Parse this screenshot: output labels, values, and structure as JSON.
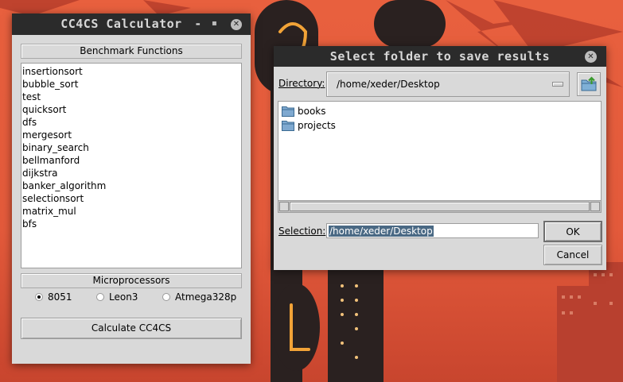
{
  "calculator_window": {
    "title": "CC4CS Calculator",
    "minimize_symbol": "-",
    "close_symbol": "✕",
    "benchmark_header": "Benchmark Functions",
    "functions": [
      "insertionsort",
      "bubble_sort",
      "test",
      "quicksort",
      "dfs",
      "mergesort",
      "binary_search",
      "bellmanford",
      "dijkstra",
      "banker_algorithm",
      "selectionsort",
      "matrix_mul",
      "bfs"
    ],
    "microprocessors_header": "Microprocessors",
    "microprocessors": [
      {
        "label": "8051",
        "selected": true
      },
      {
        "label": "Leon3",
        "selected": false
      },
      {
        "label": "Atmega328p",
        "selected": false
      }
    ],
    "calculate_button": "Calculate CC4CS"
  },
  "folder_dialog": {
    "title": "Select folder to save results",
    "close_symbol": "✕",
    "directory_label": "Directory:",
    "directory_value": "/home/xeder/Desktop",
    "folders": [
      "books",
      "projects"
    ],
    "selection_label": "Selection:",
    "selection_value": "/home/xeder/Desktop",
    "ok_button": "OK",
    "cancel_button": "Cancel"
  },
  "colors": {
    "titlebar": "#2b2b2b",
    "window_bg": "#d9d9d9",
    "selection_highlight": "#4a6984",
    "wallpaper_bg": "#e2583a"
  },
  "icons": [
    "close-icon",
    "folder-icon",
    "new-folder-icon",
    "chevron-down-icon"
  ]
}
